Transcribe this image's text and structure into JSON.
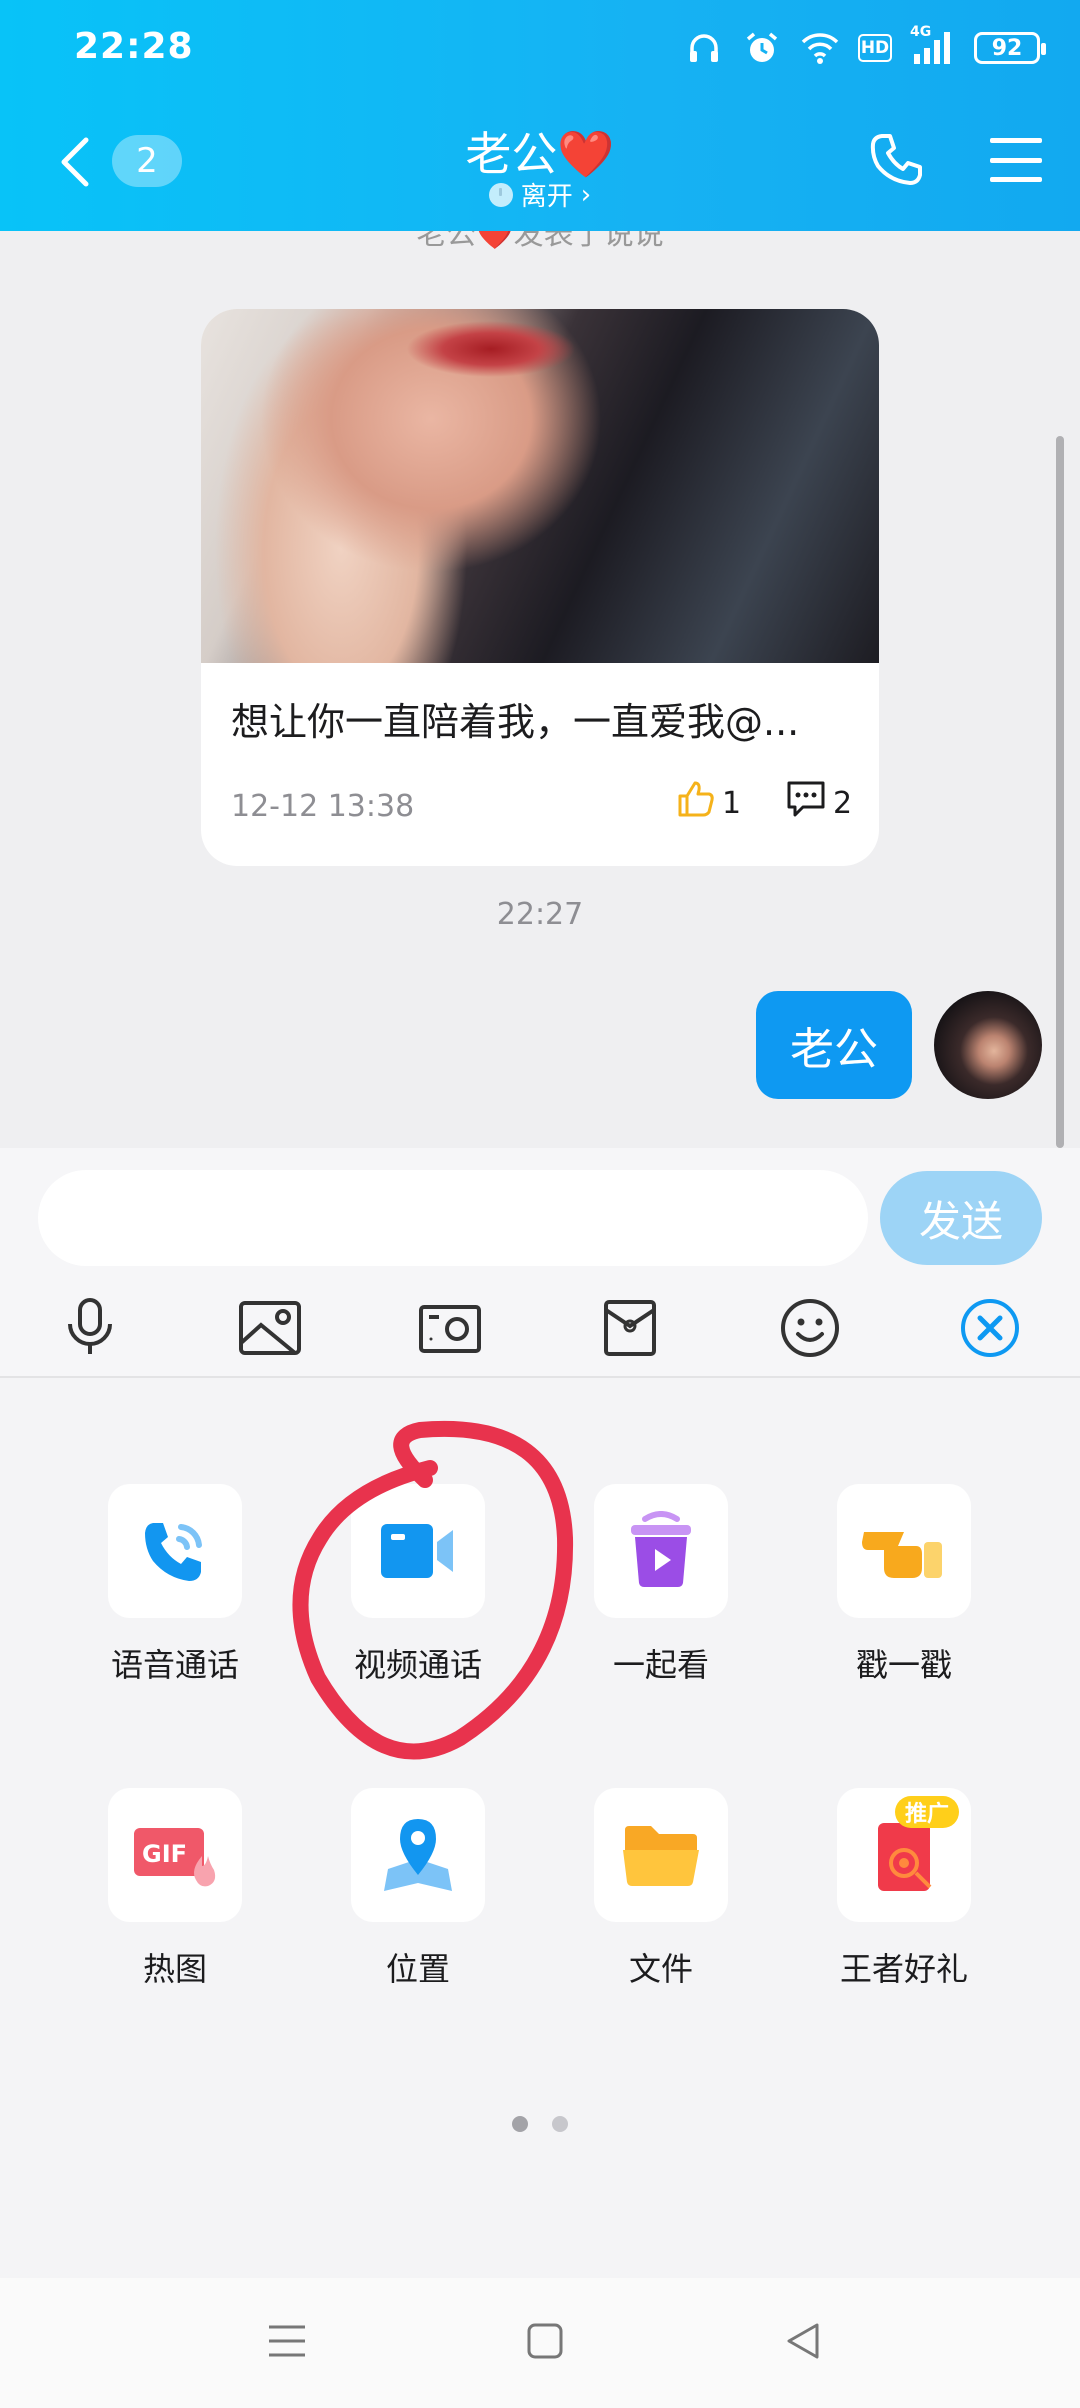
{
  "status_bar": {
    "time": "22:28",
    "battery": "92",
    "network": "4G",
    "hd": "HD"
  },
  "header": {
    "unread_count": "2",
    "contact_name": "老公",
    "contact_emoji": "❤️",
    "presence": "离开",
    "presence_chevron": "›"
  },
  "chat": {
    "system_note": "老公❤️发表了说说",
    "post": {
      "text": "想让你一直陪着我，一直爱我@...",
      "date": "12-12 13:38",
      "likes": "1",
      "comments": "2"
    },
    "timestamp": "22:27",
    "sent_message": "老公"
  },
  "composer": {
    "input_value": "",
    "input_placeholder": "",
    "send_label": "发送"
  },
  "toolbar": {
    "icons": [
      "microphone-icon",
      "photo-icon",
      "camera-icon",
      "red-packet-icon",
      "emoji-icon",
      "close-panel-icon"
    ]
  },
  "more_panel": {
    "items": [
      {
        "label": "语音通话",
        "icon": "voice-call-icon"
      },
      {
        "label": "视频通话",
        "icon": "video-call-icon"
      },
      {
        "label": "一起看",
        "icon": "watch-together-icon"
      },
      {
        "label": "戳一戳",
        "icon": "poke-icon"
      },
      {
        "label": "热图",
        "icon": "gif-icon"
      },
      {
        "label": "位置",
        "icon": "location-icon"
      },
      {
        "label": "文件",
        "icon": "folder-icon"
      },
      {
        "label": "王者好礼",
        "icon": "gift-icon",
        "badge": "推广"
      }
    ],
    "page_count": 2,
    "current_page": 1
  },
  "colors": {
    "accent": "#0e99f2",
    "header": "#16b2f3",
    "annotation": "#e8334d"
  }
}
